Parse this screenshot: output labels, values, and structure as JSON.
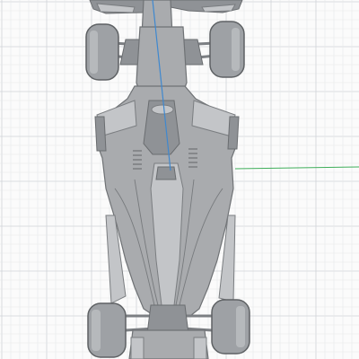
{
  "viewport": {
    "background": "#fbfbfb",
    "grid_color": "#e6e8ea",
    "grid_major_color": "#d0d4d8"
  },
  "axes": {
    "y_axis_color": "#3f88cf",
    "x_axis_color": "#3fae5a"
  },
  "model": {
    "name": "",
    "surface_color": "#a9abae",
    "edge_color": "#6f7275"
  }
}
